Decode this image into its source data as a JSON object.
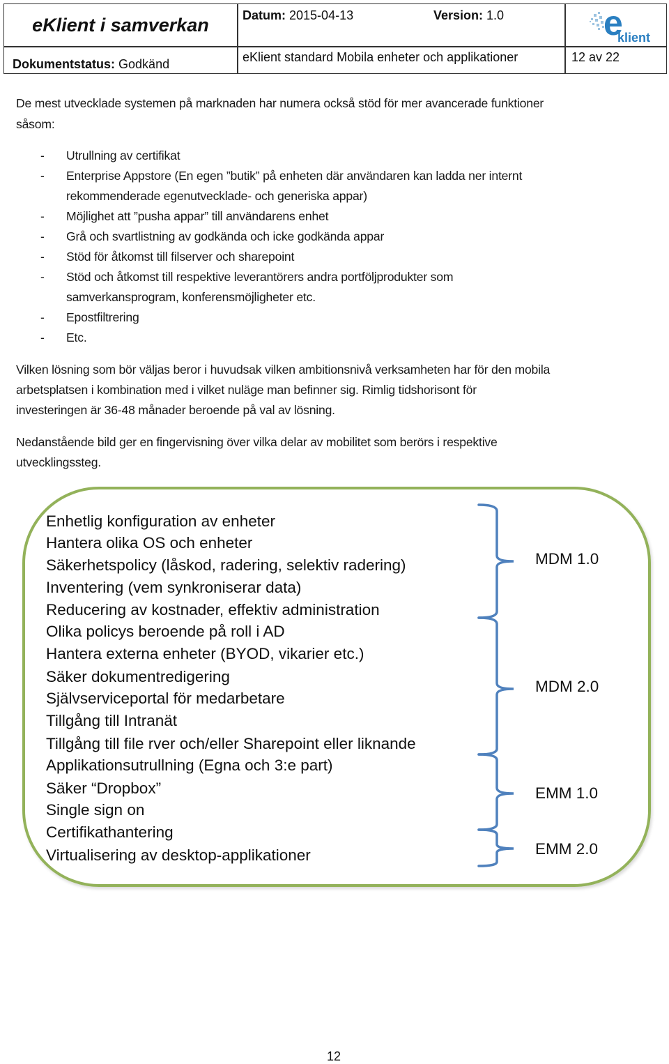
{
  "header": {
    "doc_title": "eKlient i samverkan",
    "date_label": "Datum:",
    "date_value": "2015-04-13",
    "version_label": "Version:",
    "version_value": "1.0",
    "status_label": "Dokumentstatus:",
    "status_value": "Godkänd",
    "document_name": "eKlient standard Mobila enheter och applikationer",
    "page_of": "12 av 22",
    "logo_text": "klient",
    "logo_letter": "e"
  },
  "intro": {
    "line1": "De mest utvecklade systemen på marknaden har numera också stöd för mer avancerade funktioner",
    "line2": "såsom:"
  },
  "bullets": [
    {
      "dash": "-",
      "lines": [
        "Utrullning av certifikat"
      ]
    },
    {
      "dash": "-",
      "lines": [
        "Enterprise Appstore (En egen ”butik” på enheten där användaren kan ladda ner internt",
        "rekommenderade egenutvecklade- och generiska appar)"
      ]
    },
    {
      "dash": "-",
      "lines": [
        "Möjlighet att ”pusha appar” till användarens enhet"
      ]
    },
    {
      "dash": "-",
      "lines": [
        "Grå och svartlistning av godkända och icke godkända appar"
      ]
    },
    {
      "dash": "-",
      "lines": [
        "Stöd för åtkomst till filserver och sharepoint"
      ]
    },
    {
      "dash": "-",
      "lines": [
        "Stöd och åtkomst till respektive leverantörers andra portföljprodukter som",
        "samverkansprogram, konferensmöjligheter etc."
      ]
    },
    {
      "dash": "-",
      "lines": [
        "Epostfiltrering"
      ]
    },
    {
      "dash": "-",
      "lines": [
        "Etc."
      ]
    }
  ],
  "paragraph2": {
    "line1": "Vilken lösning som bör väljas beror i huvudsak vilken ambitionsnivå verksamheten har för den mobila",
    "line2": "arbetsplatsen i kombination med i vilket nuläge man befinner sig. Rimlig tidshorisont för",
    "line3": "investeringen är 36-48 månader beroende på val av lösning."
  },
  "paragraph3": {
    "line1": "Nedanstående bild ger en fingervisning över vilka delar av mobilitet som berörs i respektive",
    "line2": "utvecklingssteg."
  },
  "diagram": {
    "features": [
      "Enhetlig konfiguration av enheter",
      "Hantera olika OS och enheter",
      "Säkerhetspolicy (låskod, radering, selektiv radering)",
      "Inventering (vem synkroniserar data)",
      "Reducering av kostnader, effektiv administration",
      "Olika policys beroende på roll i AD",
      "Hantera externa enheter (BYOD, vikarier etc.)",
      "Säker dokumentredigering",
      "Självserviceportal för medarbetare",
      "Tillgång till Intranät",
      "Tillgång till file  rver och/eller Sharepoint eller liknande",
      "Applikationsutrullning (Egna och 3:e part)",
      "Säker “Dropbox”",
      "Single sign on",
      "Certifikathantering",
      "Virtualisering av desktop-applikationer"
    ],
    "stages": [
      {
        "label": "MDM 1.0",
        "features_from": 1,
        "features_to": 5
      },
      {
        "label": "MDM 2.0",
        "features_from": 6,
        "features_to": 11
      },
      {
        "label": "EMM 1.0",
        "features_from": 12,
        "features_to": 14
      },
      {
        "label": "EMM 2.0",
        "features_from": 15,
        "features_to": 16
      }
    ],
    "colors": {
      "border": "#93b25a",
      "brace": "#4f81bd"
    }
  },
  "footer": {
    "page_number": "12"
  }
}
